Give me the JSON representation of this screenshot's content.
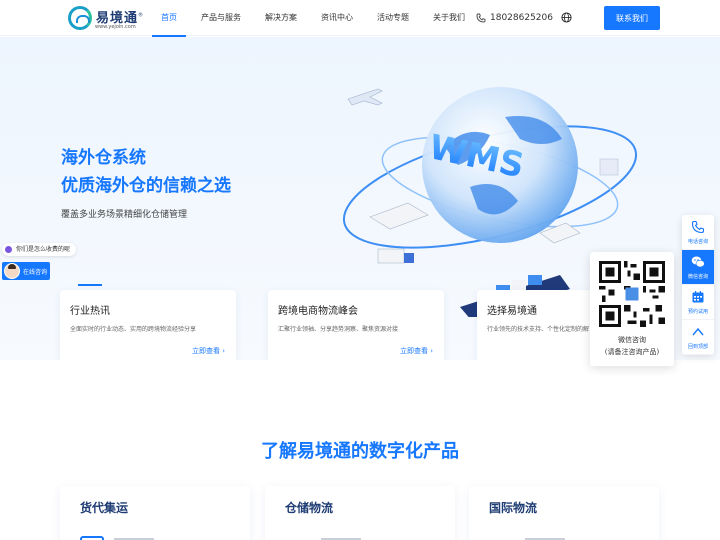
{
  "header": {
    "logo_name": "易境通",
    "logo_reg": "®",
    "logo_url": "www.yejoin.com",
    "nav": [
      "首页",
      "产品与服务",
      "解决方案",
      "资讯中心",
      "活动专题",
      "关于我们"
    ],
    "phone": "18028625206",
    "contact_button": "联系我们"
  },
  "hero": {
    "title": "海外仓系统",
    "subtitle": "优质海外仓的信赖之选",
    "desc": "覆盖多业务场景精细化仓储管理",
    "art_wms": "WMS",
    "chat_bubble": "你们是怎么收费的呢",
    "agent_label": "在线咨询"
  },
  "cards": [
    {
      "title": "行业热讯",
      "desc": "全面实时的行业动态、实用的跨境物流经验分享",
      "link": "立即查看"
    },
    {
      "title": "跨境电商物流峰会",
      "desc": "汇聚行业领袖、分享趋势洞察、聚焦资源对接",
      "link": "立即查看"
    },
    {
      "title": "选择易境通",
      "desc": "行业领先的技术支持、个性化定制的解"
    }
  ],
  "side_bar": {
    "items": [
      "电话咨询",
      "微信咨询",
      "预约试用",
      "回到顶部"
    ],
    "active_index": 1,
    "qr_title": "微信咨询",
    "qr_sub": "(请备注咨询产品)"
  },
  "section": {
    "title": "了解易境通的数字化产品",
    "products": [
      "货代集运",
      "仓储物流",
      "国际物流"
    ]
  },
  "colors": {
    "accent": "#1677ff",
    "dark_blue": "#1f3d74",
    "hero_bg": "#edf5fe"
  },
  "icons": [
    "phone-icon",
    "globe-icon",
    "wechat-icon",
    "calendar-icon",
    "arrow-up-icon",
    "chevron-right-icon",
    "qr-code-icon"
  ]
}
